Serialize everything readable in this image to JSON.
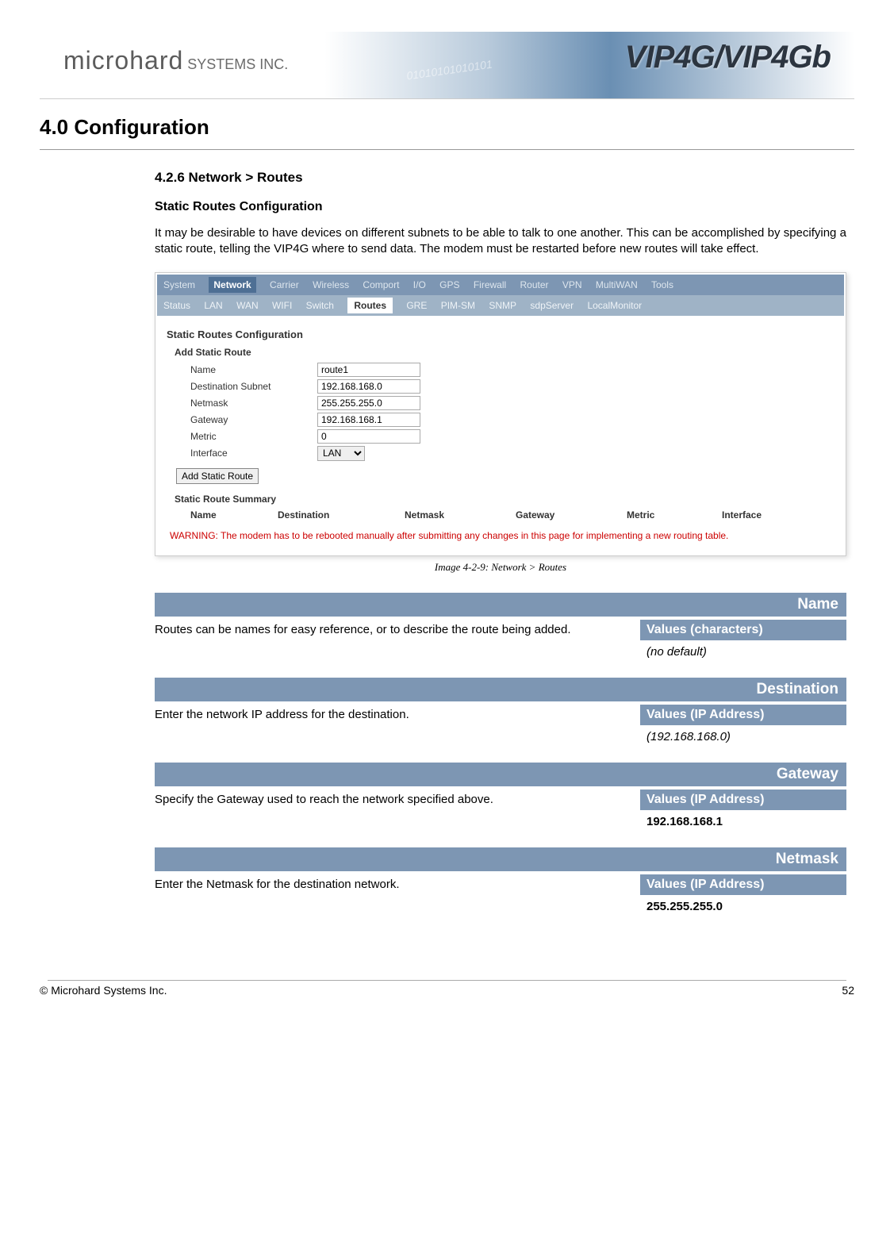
{
  "header": {
    "brand_main": "microhard",
    "brand_sub": " SYSTEMS INC.",
    "brand_right": "VIP4G/VIP4Gb",
    "binary_deco": "01010101010101"
  },
  "title": "4.0  Configuration",
  "section": "4.2.6 Network > Routes",
  "subsection": "Static Routes Configuration",
  "intro": "It may be desirable to have devices on different subnets to be able to talk to one another. This can be accomplished by specifying a static route, telling the VIP4G where to send data. The modem must be restarted before new routes will take effect.",
  "screenshot": {
    "nav1": [
      "System",
      "Network",
      "Carrier",
      "Wireless",
      "Comport",
      "I/O",
      "GPS",
      "Firewall",
      "Router",
      "VPN",
      "MultiWAN",
      "Tools"
    ],
    "nav1_active": "Network",
    "nav2": [
      "Status",
      "LAN",
      "WAN",
      "WIFI",
      "Switch",
      "Routes",
      "GRE",
      "PIM-SM",
      "SNMP",
      "sdpServer",
      "LocalMonitor"
    ],
    "nav2_active": "Routes",
    "panel_title": "Static Routes Configuration",
    "add_title": "Add Static Route",
    "fields": {
      "name_label": "Name",
      "name_val": "route1",
      "dest_label": "Destination Subnet",
      "dest_val": "192.168.168.0",
      "mask_label": "Netmask",
      "mask_val": "255.255.255.0",
      "gw_label": "Gateway",
      "gw_val": "192.168.168.1",
      "metric_label": "Metric",
      "metric_val": "0",
      "iface_label": "Interface",
      "iface_val": "LAN"
    },
    "button": "Add Static Route",
    "summary_title": "Static Route Summary",
    "cols": [
      "Name",
      "Destination",
      "Netmask",
      "Gateway",
      "Metric",
      "Interface"
    ],
    "warning": "WARNING: The modem has to be rebooted manually after submitting any changes in this page for implementing a new routing table."
  },
  "caption": "Image 4-2-9:  Network > Routes",
  "params": [
    {
      "title": "Name",
      "desc": "Routes can be names for easy reference, or to describe the route being added.",
      "vals_head": "Values (characters)",
      "vals_body": "(no default)",
      "body_style": "italic"
    },
    {
      "title": "Destination",
      "desc": "Enter the network IP address for the destination.",
      "vals_head": "Values (IP Address)",
      "vals_body": "(192.168.168.0)",
      "body_style": "italic"
    },
    {
      "title": "Gateway",
      "desc": "Specify the Gateway used to reach the network specified above.",
      "vals_head": "Values (IP Address)",
      "vals_body": "192.168.168.1",
      "body_style": "bold"
    },
    {
      "title": "Netmask",
      "desc": "Enter the Netmask for the destination network.",
      "vals_head": "Values (IP Address)",
      "vals_body": "255.255.255.0",
      "body_style": "bold"
    }
  ],
  "footer_left": "© Microhard Systems Inc.",
  "footer_right": "52"
}
